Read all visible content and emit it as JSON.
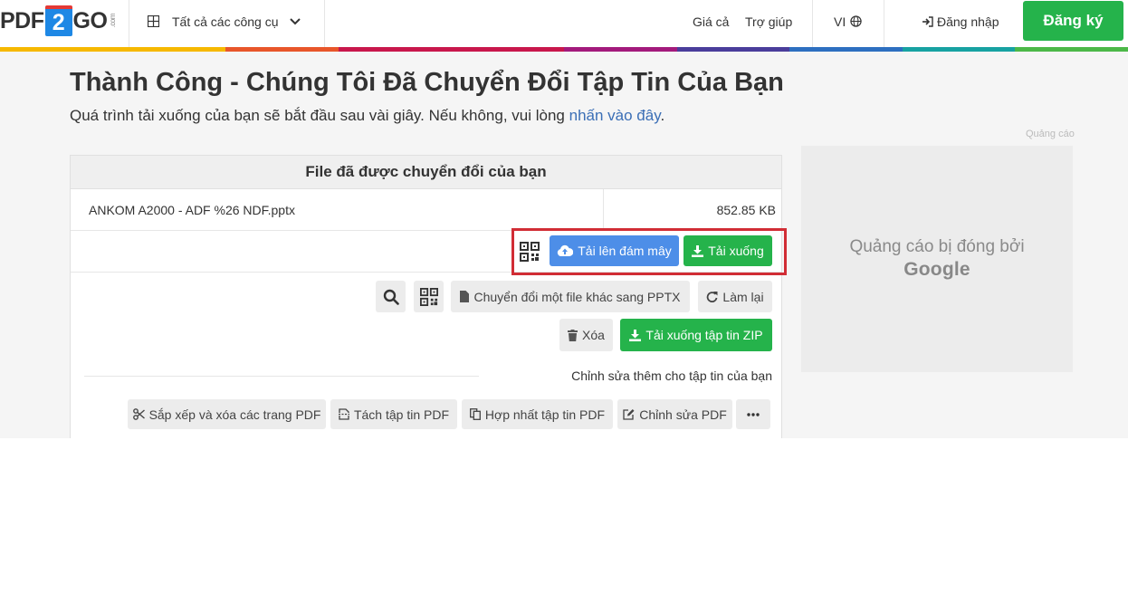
{
  "header": {
    "logo": {
      "pdf": "PDF",
      "two": "2",
      "go": "GO",
      "com": ".com"
    },
    "tools_label": "Tất cả các công cụ",
    "nav": {
      "price": "Giá cả",
      "help": "Trợ giúp",
      "lang": "VI",
      "login": "Đăng nhập",
      "signup": "Đăng ký"
    },
    "rainbow_colors": [
      "#f6b800",
      "#f6b800",
      "#e8562a",
      "#c8174c",
      "#c8174c",
      "#a31a7c",
      "#4a3d9b",
      "#2d6fc0",
      "#17a2a2",
      "#4cb848"
    ]
  },
  "page": {
    "title": "Thành Công - Chúng Tôi Đã Chuyển Đổi Tập Tin Của Bạn",
    "subtitle_before": "Quá trình tải xuống của bạn sẽ bắt đầu sau vài giây. Nếu không, vui lòng ",
    "subtitle_link": "nhấn vào đây",
    "subtitle_after": "."
  },
  "card": {
    "header": "File đã được chuyển đổi của bạn",
    "file_name": "ANKOM A2000 - ADF %26 NDF.pptx",
    "file_size": "852.85 KB",
    "upload_cloud": "Tải lên đám mây",
    "download": "Tải xuống",
    "convert_other": "Chuyển đổi một file khác sang PPTX",
    "redo": "Làm lại",
    "delete": "Xóa",
    "download_zip": "Tải xuống tập tin ZIP",
    "more_edit_label": "Chỉnh sửa thêm cho tập tin của bạn",
    "tools": {
      "sort": "Sắp xếp và xóa các trang PDF",
      "split": "Tách tập tin PDF",
      "merge": "Hợp nhất tập tin PDF",
      "edit": "Chỉnh sửa PDF"
    }
  },
  "ad": {
    "label": "Quảng cáo",
    "closed_text": "Quảng cáo bị đóng bởi",
    "brand": "Google"
  },
  "colors": {
    "accent_green": "#25b34b",
    "accent_blue": "#4d8ee8",
    "highlight_red": "#d12d35",
    "link": "#3b6fb6"
  }
}
